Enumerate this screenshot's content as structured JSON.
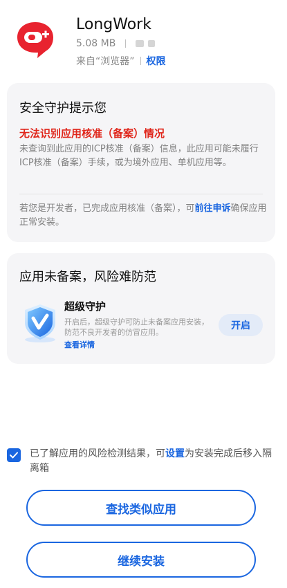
{
  "app": {
    "name": "LongWork",
    "size": "5.08 MB",
    "source_prefix": "来自“浏览器”",
    "permission_link": "权限"
  },
  "security_card": {
    "title": "安全守护提示您",
    "warning_title": "无法识别应用核准（备案）情况",
    "warning_body": "未查询到此应用的ICP核准（备案）信息，此应用可能未履行ICP核准（备案）手续，或为境外应用、单机应用等。",
    "developer_text": "若您是开发者，已完成应用核准（备案），可",
    "developer_link": "前往申诉",
    "developer_suffix": "确保应用正常安装。"
  },
  "guard_card": {
    "title": "应用未备案，风险难防范",
    "guard_title": "超级守护",
    "guard_desc": "开启后，超级守护可防止未备案应用安装，防范不良开发者的仿冒应用。",
    "details_link": "查看详情",
    "enable_button": "开启"
  },
  "consent": {
    "text_before": "已了解应用的风险检测结果，可",
    "settings_link": "设置",
    "text_after": "为安装完成后移入隔离箱",
    "checked": true
  },
  "buttons": {
    "find_similar": "查找类似应用",
    "continue_install": "继续安装"
  },
  "colors": {
    "accent": "#1a66e0",
    "warning": "#e0261b",
    "brand_red": "#e8232f",
    "card_bg": "#f5f5f7"
  }
}
